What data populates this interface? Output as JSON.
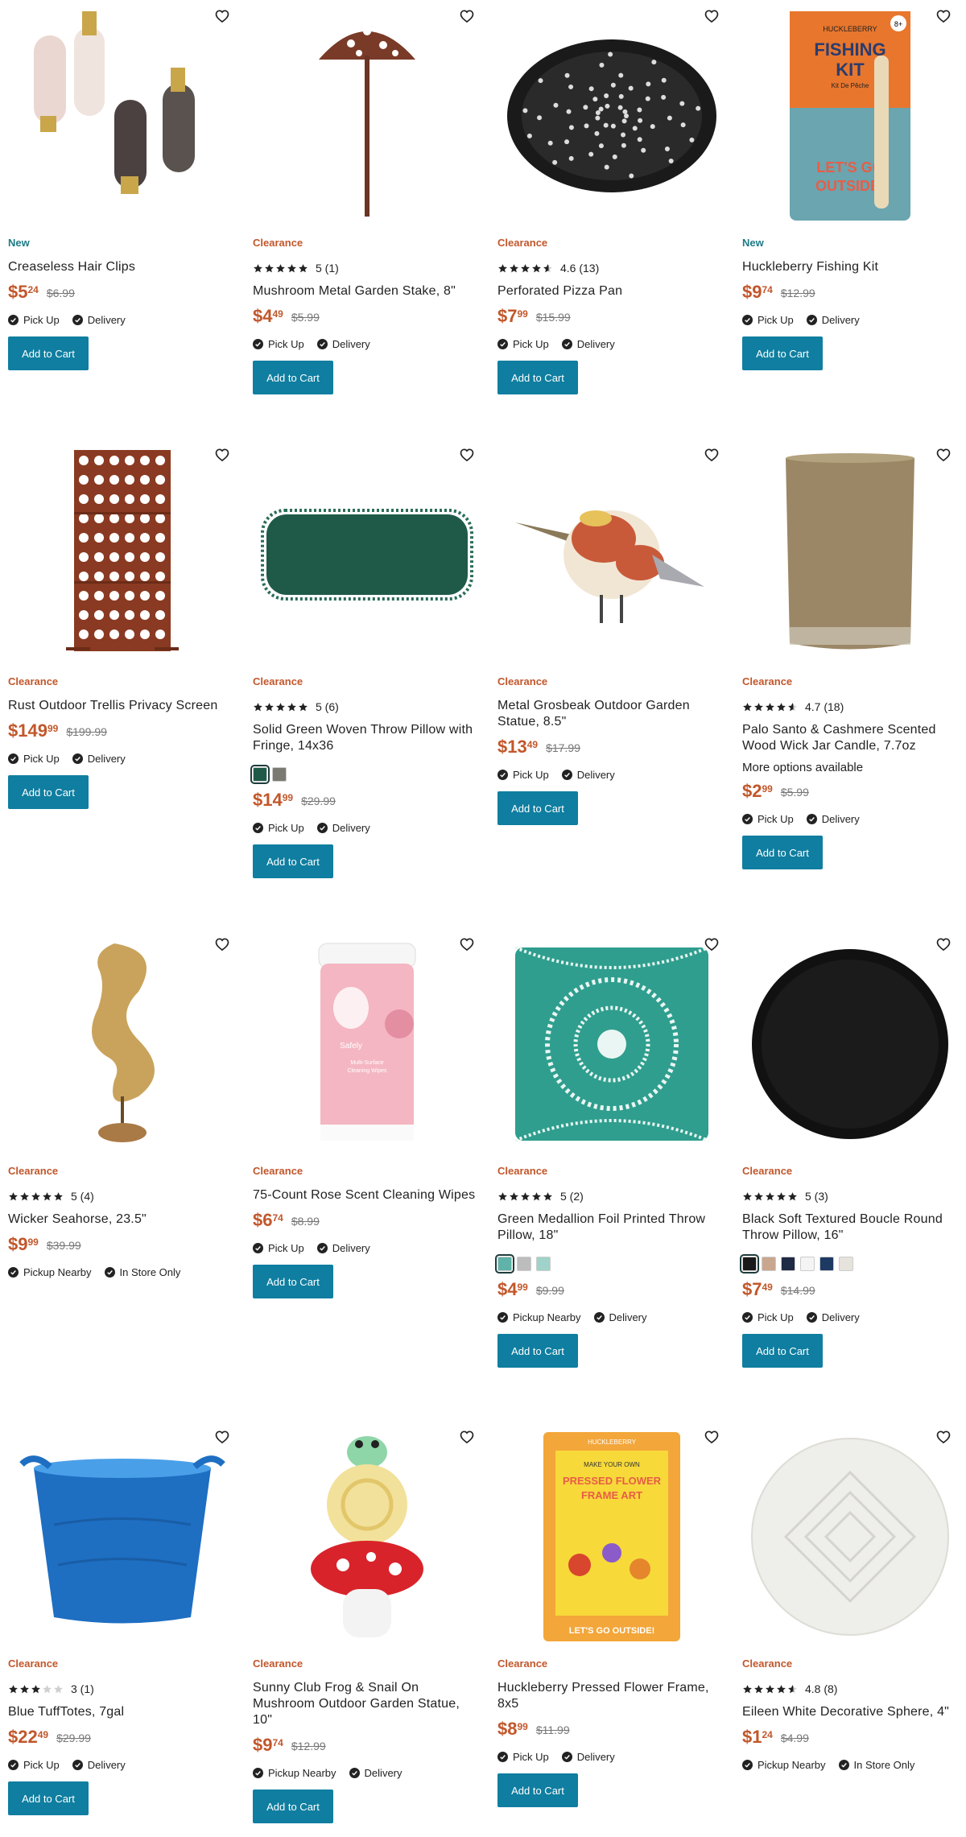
{
  "icons": {
    "heart": "heart-outline-icon",
    "check": "check-circle-icon",
    "star": "star-icon"
  },
  "colors": {
    "clearance": "#c2572b",
    "new": "#1e7b85",
    "button": "#0f7ea0",
    "price": "#c2572b"
  },
  "common": {
    "add_to_cart": "Add to Cart"
  },
  "products": [
    {
      "id": "p1",
      "tag": "New",
      "tag_type": "new",
      "rating": null,
      "reviews": "",
      "name": "Creaseless Hair Clips",
      "price_dollars": "$5",
      "price_cents": "24",
      "was": "$6.99",
      "fulfillment": [
        "Pick Up",
        "Delivery"
      ],
      "swatches": [],
      "more": "",
      "image": "hair-clips"
    },
    {
      "id": "p2",
      "tag": "Clearance",
      "tag_type": "clear",
      "rating": 5,
      "reviews": "5 (1)",
      "name": "Mushroom Metal Garden Stake, 8\"",
      "price_dollars": "$4",
      "price_cents": "49",
      "was": "$5.99",
      "fulfillment": [
        "Pick Up",
        "Delivery"
      ],
      "swatches": [],
      "more": "",
      "image": "mushroom-stake"
    },
    {
      "id": "p3",
      "tag": "Clearance",
      "tag_type": "clear",
      "rating": 4.6,
      "reviews": "4.6 (13)",
      "name": "Perforated Pizza Pan",
      "price_dollars": "$7",
      "price_cents": "99",
      "was": "$15.99",
      "fulfillment": [
        "Pick Up",
        "Delivery"
      ],
      "swatches": [],
      "more": "",
      "image": "pizza-pan"
    },
    {
      "id": "p4",
      "tag": "New",
      "tag_type": "new",
      "rating": null,
      "reviews": "",
      "name": "Huckleberry Fishing Kit",
      "price_dollars": "$9",
      "price_cents": "74",
      "was": "$12.99",
      "fulfillment": [
        "Pick Up",
        "Delivery"
      ],
      "swatches": [],
      "more": "",
      "image": "fishing-kit",
      "image_text": {
        "brand": "HUCKLEBERRY",
        "title1": "FISHING",
        "title2": "KIT",
        "sub": "Kit De Pêche",
        "bottom1": "LET'S GO",
        "bottom2": "OUTSIDE!",
        "age": "8+"
      }
    },
    {
      "id": "p5",
      "tag": "Clearance",
      "tag_type": "clear",
      "rating": null,
      "reviews": "",
      "name": "Rust Outdoor Trellis Privacy Screen",
      "price_dollars": "$149",
      "price_cents": "99",
      "was": "$199.99",
      "fulfillment": [
        "Pick Up",
        "Delivery"
      ],
      "swatches": [],
      "more": "",
      "image": "trellis"
    },
    {
      "id": "p6",
      "tag": "Clearance",
      "tag_type": "clear",
      "rating": 5,
      "reviews": "5 (6)",
      "name": "Solid Green Woven Throw Pillow with Fringe, 14x36",
      "price_dollars": "$14",
      "price_cents": "99",
      "was": "$29.99",
      "fulfillment": [
        "Pick Up",
        "Delivery"
      ],
      "swatches": [
        "#1f5a48",
        "#7a7a72"
      ],
      "more": "",
      "image": "green-pillow"
    },
    {
      "id": "p7",
      "tag": "Clearance",
      "tag_type": "clear",
      "rating": null,
      "reviews": "",
      "name": "Metal Grosbeak Outdoor Garden Statue, 8.5\"",
      "price_dollars": "$13",
      "price_cents": "49",
      "was": "$17.99",
      "fulfillment": [
        "Pick Up",
        "Delivery"
      ],
      "swatches": [],
      "more": "",
      "image": "bird"
    },
    {
      "id": "p8",
      "tag": "Clearance",
      "tag_type": "clear",
      "rating": 4.7,
      "reviews": "4.7 (18)",
      "name": "Palo Santo & Cashmere Scented Wood Wick Jar Candle, 7.7oz",
      "price_dollars": "$2",
      "price_cents": "99",
      "was": "$5.99",
      "fulfillment": [
        "Pick Up",
        "Delivery"
      ],
      "swatches": [],
      "more": "More options available",
      "image": "candle"
    },
    {
      "id": "p9",
      "tag": "Clearance",
      "tag_type": "clear",
      "rating": 5,
      "reviews": "5 (4)",
      "name": "Wicker Seahorse, 23.5\"",
      "price_dollars": "$9",
      "price_cents": "99",
      "was": "$39.99",
      "fulfillment": [
        "Pickup Nearby",
        "In Store Only"
      ],
      "swatches": [],
      "more": "",
      "image": "seahorse",
      "no_button": true
    },
    {
      "id": "p10",
      "tag": "Clearance",
      "tag_type": "clear",
      "rating": null,
      "reviews": "",
      "name": "75-Count Rose Scent Cleaning Wipes",
      "price_dollars": "$6",
      "price_cents": "74",
      "was": "$8.99",
      "fulfillment": [
        "Pick Up",
        "Delivery"
      ],
      "swatches": [],
      "more": "",
      "image": "wipes",
      "image_text": {
        "brand": "Safely",
        "line1": "Multi-Surface",
        "line2": "Cleaning Wipes"
      }
    },
    {
      "id": "p11",
      "tag": "Clearance",
      "tag_type": "clear",
      "rating": 5,
      "reviews": "5 (2)",
      "name": "Green Medallion Foil Printed Throw Pillow, 18\"",
      "price_dollars": "$4",
      "price_cents": "99",
      "was": "$9.99",
      "fulfillment": [
        "Pickup Nearby",
        "Delivery"
      ],
      "swatches": [
        "#5fb3a8",
        "#bdbdbd",
        "#9fd3c9"
      ],
      "more": "",
      "image": "medallion-pillow"
    },
    {
      "id": "p12",
      "tag": "Clearance",
      "tag_type": "clear",
      "rating": 5,
      "reviews": "5 (3)",
      "name": "Black Soft Textured Boucle Round Throw Pillow, 16\"",
      "price_dollars": "$7",
      "price_cents": "49",
      "was": "$14.99",
      "fulfillment": [
        "Pick Up",
        "Delivery"
      ],
      "swatches": [
        "#1a1a1a",
        "#c9a78e",
        "#1f2a44",
        "#f4f4f4",
        "#1d3a63",
        "#e6e3dc"
      ],
      "more": "",
      "image": "boucle-pillow"
    },
    {
      "id": "p13",
      "tag": "Clearance",
      "tag_type": "clear",
      "rating": 3,
      "reviews": "3 (1)",
      "name": "Blue TuffTotes, 7gal",
      "price_dollars": "$22",
      "price_cents": "49",
      "was": "$29.99",
      "fulfillment": [
        "Pick Up",
        "Delivery"
      ],
      "swatches": [],
      "more": "",
      "image": "blue-tote"
    },
    {
      "id": "p14",
      "tag": "Clearance",
      "tag_type": "clear",
      "rating": null,
      "reviews": "",
      "name": "Sunny Club Frog & Snail On Mushroom Outdoor Garden Statue, 10\"",
      "price_dollars": "$9",
      "price_cents": "74",
      "was": "$12.99",
      "fulfillment": [
        "Pickup Nearby",
        "Delivery"
      ],
      "swatches": [],
      "more": "",
      "image": "frog-statue"
    },
    {
      "id": "p15",
      "tag": "Clearance",
      "tag_type": "clear",
      "rating": null,
      "reviews": "",
      "name": "Huckleberry Pressed Flower Frame, 8x5",
      "price_dollars": "$8",
      "price_cents": "99",
      "was": "$11.99",
      "fulfillment": [
        "Pick Up",
        "Delivery"
      ],
      "swatches": [],
      "more": "",
      "image": "flower-frame",
      "image_text": {
        "brand": "HUCKLEBERRY",
        "line1": "MAKE YOUR OWN",
        "title1": "PRESSED FLOWER",
        "title2": "FRAME ART",
        "bottom": "LET'S GO OUTSIDE!"
      }
    },
    {
      "id": "p16",
      "tag": "Clearance",
      "tag_type": "clear",
      "rating": 4.8,
      "reviews": "4.8 (8)",
      "name": "Eileen White Decorative Sphere, 4\"",
      "price_dollars": "$1",
      "price_cents": "24",
      "was": "$4.99",
      "fulfillment": [
        "Pickup Nearby",
        "In Store Only"
      ],
      "swatches": [],
      "more": "",
      "image": "white-sphere",
      "no_button": true
    }
  ]
}
